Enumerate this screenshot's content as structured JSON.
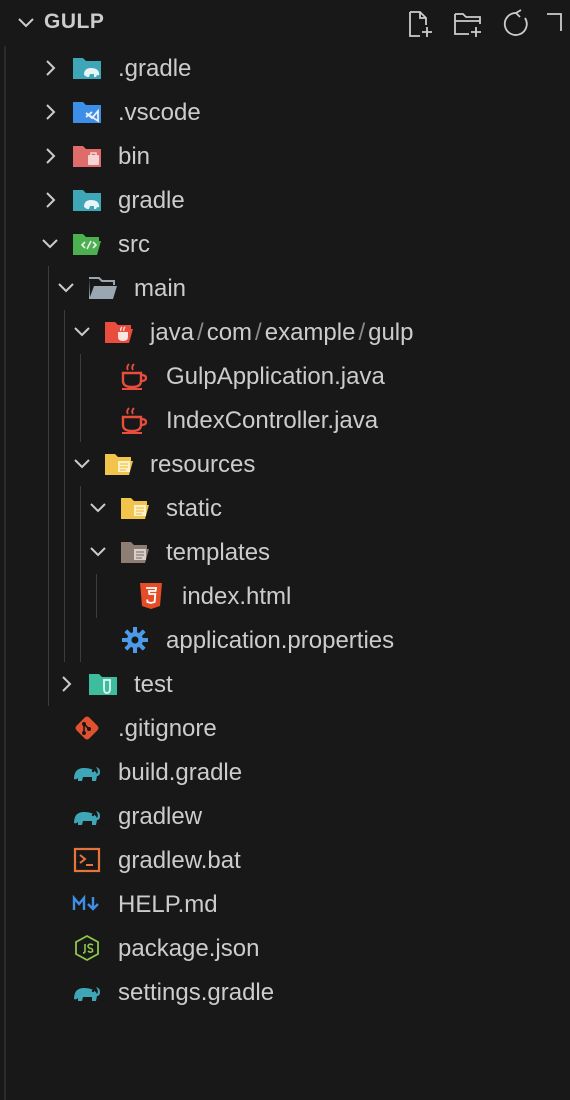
{
  "header": {
    "title": "GULP",
    "actions": [
      "new-file",
      "new-folder",
      "refresh",
      "collapse"
    ]
  },
  "tree": [
    {
      "name": ".gradle",
      "type": "folder",
      "expanded": false,
      "depth": 0,
      "icon": "gradle-folder"
    },
    {
      "name": ".vscode",
      "type": "folder",
      "expanded": false,
      "depth": 0,
      "icon": "vscode-folder"
    },
    {
      "name": "bin",
      "type": "folder",
      "expanded": false,
      "depth": 0,
      "icon": "bin-folder"
    },
    {
      "name": "gradle",
      "type": "folder",
      "expanded": false,
      "depth": 0,
      "icon": "gradle-folder"
    },
    {
      "name": "src",
      "type": "folder",
      "expanded": true,
      "depth": 0,
      "icon": "src-folder"
    },
    {
      "name": "main",
      "type": "folder",
      "expanded": true,
      "depth": 1,
      "icon": "folder-open"
    },
    {
      "name": "java/com/example/gulp",
      "parts": [
        "java",
        "com",
        "example",
        "gulp"
      ],
      "type": "folder",
      "expanded": true,
      "depth": 2,
      "icon": "java-folder"
    },
    {
      "name": "GulpApplication.java",
      "type": "file",
      "depth": 3,
      "icon": "java-file"
    },
    {
      "name": "IndexController.java",
      "type": "file",
      "depth": 3,
      "icon": "java-file"
    },
    {
      "name": "resources",
      "type": "folder",
      "expanded": true,
      "depth": 2,
      "icon": "resources-folder"
    },
    {
      "name": "static",
      "type": "folder",
      "expanded": true,
      "depth": 3,
      "icon": "resources-folder"
    },
    {
      "name": "templates",
      "type": "folder",
      "expanded": true,
      "depth": 3,
      "icon": "templates-folder"
    },
    {
      "name": "index.html",
      "type": "file",
      "depth": 4,
      "icon": "html-file"
    },
    {
      "name": "application.properties",
      "type": "file",
      "depth": 3,
      "icon": "gear-file"
    },
    {
      "name": "test",
      "type": "folder",
      "expanded": false,
      "depth": 1,
      "icon": "test-folder"
    },
    {
      "name": ".gitignore",
      "type": "file",
      "depth": 0,
      "icon": "git-file"
    },
    {
      "name": "build.gradle",
      "type": "file",
      "depth": 0,
      "icon": "gradle-file"
    },
    {
      "name": "gradlew",
      "type": "file",
      "depth": 0,
      "icon": "gradle-file"
    },
    {
      "name": "gradlew.bat",
      "type": "file",
      "depth": 0,
      "icon": "terminal-file"
    },
    {
      "name": "HELP.md",
      "type": "file",
      "depth": 0,
      "icon": "markdown-file"
    },
    {
      "name": "package.json",
      "type": "file",
      "depth": 0,
      "icon": "nodejs-file"
    },
    {
      "name": "settings.gradle",
      "type": "file",
      "depth": 0,
      "icon": "gradle-file"
    }
  ],
  "colors": {
    "background": "#181818",
    "text": "#cccccc",
    "java": "#e84d3d",
    "gradle": "#3fa6b8",
    "folder_yellow": "#f2c44b",
    "vscode": "#3d8ee6",
    "html": "#e44d26",
    "gear": "#4b9be8",
    "node": "#8cc84b"
  }
}
